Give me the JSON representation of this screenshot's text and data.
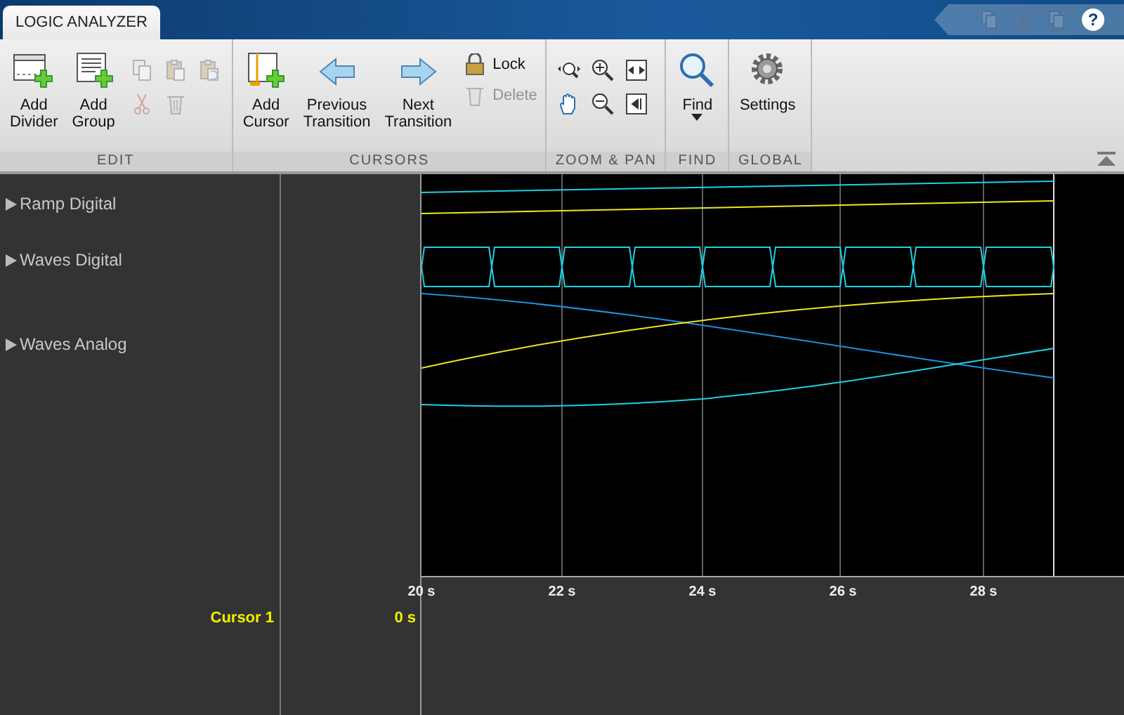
{
  "window": {
    "tab": {
      "label": "LOGIC ANALYZER",
      "selected": true
    }
  },
  "quick_access": [
    {
      "kind": "copy",
      "disabled": true
    },
    {
      "kind": "cut",
      "disabled": true
    },
    {
      "kind": "paste",
      "disabled": true
    },
    {
      "kind": "help",
      "label": "?",
      "disabled": false
    }
  ],
  "toolstrip": {
    "sections": [
      {
        "label": "EDIT",
        "items": [
          {
            "kind": "large",
            "label": "Add\nDivider",
            "disabled": false
          },
          {
            "kind": "large",
            "label": "Add\nGroup",
            "disabled": false
          },
          {
            "kind": "small",
            "disabled": true
          },
          {
            "kind": "small",
            "disabled": true
          },
          {
            "kind": "small",
            "disabled": true
          },
          {
            "kind": "small",
            "disabled": true
          },
          {
            "kind": "small",
            "disabled": true
          }
        ]
      },
      {
        "label": "CURSORS",
        "items": [
          {
            "kind": "large",
            "label": "Add\nCursor",
            "disabled": false
          },
          {
            "kind": "large",
            "label": "Previous\nTransition",
            "disabled": false
          },
          {
            "kind": "large",
            "label": "Next\nTransition",
            "disabled": false
          },
          {
            "kind": "labeled",
            "label": "Lock",
            "disabled": false
          },
          {
            "kind": "labeled",
            "label": "Delete",
            "disabled": true
          }
        ]
      },
      {
        "label": "ZOOM & PAN",
        "items": [
          {
            "kind": "small",
            "disabled": false
          },
          {
            "kind": "small",
            "disabled": false
          },
          {
            "kind": "small",
            "disabled": false
          },
          {
            "kind": "small",
            "disabled": false
          },
          {
            "kind": "small",
            "disabled": false
          },
          {
            "kind": "small",
            "disabled": false
          }
        ]
      },
      {
        "label": "FIND",
        "items": [
          {
            "kind": "dropdown",
            "label": "Find",
            "disabled": false
          }
        ]
      },
      {
        "label": "GLOBAL",
        "items": [
          {
            "kind": "large",
            "label": "Settings",
            "disabled": false
          }
        ]
      }
    ]
  },
  "signals": [
    {
      "name": "Ramp Digital",
      "expanded": false
    },
    {
      "name": "Waves Digital",
      "expanded": false
    },
    {
      "name": "Waves Analog",
      "expanded": false
    }
  ],
  "time_axis": {
    "ticks": [
      "20 s",
      "22 s",
      "24 s",
      "26 s",
      "28 s"
    ]
  },
  "cursors": [
    {
      "name": "Cursor 1",
      "time": "0 s"
    }
  ]
}
